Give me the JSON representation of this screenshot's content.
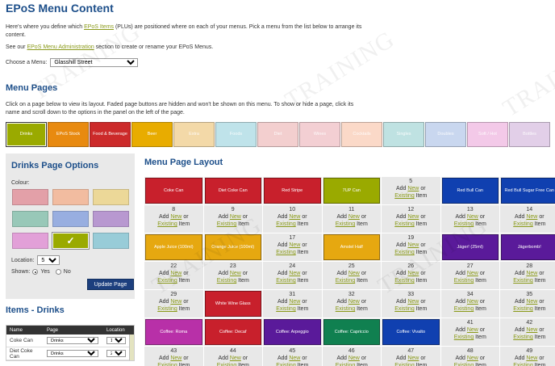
{
  "title": "EPoS Menu Content",
  "intro": {
    "before": "Here's where you define which ",
    "link": "EPoS Items",
    "after": " (PLUs) are positioned where on each of your menus. Pick a menu from the list below to arrange its content."
  },
  "intro2": {
    "before": "See our ",
    "link": "EPoS Menu Administration",
    "after": " section to create or rename your EPoS Menus."
  },
  "choose": {
    "label": "Choose a Menu:",
    "value": "Glasshill Street"
  },
  "watermark": "TRAINING",
  "menu_pages": {
    "heading": "Menu Pages",
    "desc": "Click on a page below to view its layout. Faded page buttons are hidden and won't be shown on this menu. To show or hide a page, click its name and scroll down to the options in the panel on the left of the page.",
    "pages": [
      {
        "label": "Drinks",
        "color": "#9aaa00",
        "faded": false,
        "selected": true
      },
      {
        "label": "EPoS Stock",
        "color": "#e88a10",
        "faded": false
      },
      {
        "label": "Food & Beverage",
        "color": "#cc2a2a",
        "faded": false
      },
      {
        "label": "Beer",
        "color": "#e8ac00",
        "faded": false
      },
      {
        "label": "Extra",
        "color": "#f3d9a8",
        "faded": true
      },
      {
        "label": "Foods",
        "color": "#bfe3ea",
        "faded": true
      },
      {
        "label": "Diet",
        "color": "#f3cfcf",
        "faded": true
      },
      {
        "label": "Wines",
        "color": "#f3cfd3",
        "faded": true
      },
      {
        "label": "Cocktails",
        "color": "#fbd9c8",
        "faded": true
      },
      {
        "label": "Singles",
        "color": "#bfe2e2",
        "faded": true
      },
      {
        "label": "Doubles",
        "color": "#c9d7ef",
        "faded": true
      },
      {
        "label": "Soft / Hot",
        "color": "#f3c9e8",
        "faded": true
      },
      {
        "label": "Bottles",
        "color": "#e2cfe8",
        "faded": true
      }
    ]
  },
  "options": {
    "title": "Drinks Page Options",
    "colour_label": "Colour:",
    "swatches": [
      {
        "color": "#e3a0a8",
        "selected": false,
        "mark": ""
      },
      {
        "color": "#f2bca0",
        "selected": false,
        "mark": ""
      },
      {
        "color": "#ecd898",
        "selected": false,
        "mark": ""
      },
      {
        "color": "#98c8b8",
        "selected": false,
        "mark": ""
      },
      {
        "color": "#98aee0",
        "selected": false,
        "mark": ""
      },
      {
        "color": "#b898d0",
        "selected": false,
        "mark": ""
      },
      {
        "color": "#e2a0d8",
        "selected": false,
        "mark": ""
      },
      {
        "color": "#9aaa00",
        "selected": true,
        "mark": "✓"
      },
      {
        "color": "#98ccd8",
        "selected": false,
        "mark": ""
      }
    ],
    "location_label": "Location:",
    "location_value": "5",
    "shown_label": "Shown:",
    "yes_label": "Yes",
    "no_label": "No",
    "update_label": "Update Page"
  },
  "items": {
    "title": "Items - Drinks",
    "headers": [
      "Name",
      "Page",
      "Location"
    ],
    "rows": [
      {
        "name": "Coke Can",
        "page": "Drinks",
        "location": "1"
      },
      {
        "name": "Diet Coke Can",
        "page": "Drinks",
        "location": "2"
      }
    ]
  },
  "layout": {
    "title": "Menu Page Layout",
    "add": "Add",
    "new": "New",
    "or": "or",
    "existing": "Existing",
    "item": "Item",
    "cells": [
      {
        "type": "item",
        "label": "Coke Can",
        "color": "#c8202c"
      },
      {
        "type": "item",
        "label": "Diet Coke Can",
        "color": "#c8202c"
      },
      {
        "type": "item",
        "label": "Red Stripe",
        "color": "#c8202c"
      },
      {
        "type": "item",
        "label": "7UP Can",
        "color": "#9aaa00"
      },
      {
        "type": "empty",
        "num": "5"
      },
      {
        "type": "item",
        "label": "Red Bull Can",
        "color": "#1040b0"
      },
      {
        "type": "item",
        "label": "Red Bull Sugar Free Can",
        "color": "#1040b0"
      },
      {
        "type": "empty",
        "num": "8"
      },
      {
        "type": "empty",
        "num": "9"
      },
      {
        "type": "empty",
        "num": "10"
      },
      {
        "type": "empty",
        "num": "11"
      },
      {
        "type": "empty",
        "num": "12"
      },
      {
        "type": "empty",
        "num": "13"
      },
      {
        "type": "empty",
        "num": "14"
      },
      {
        "type": "item",
        "label": "Apple Juice (100ml)",
        "color": "#e6a810"
      },
      {
        "type": "item",
        "label": "Orange Juice (100ml)",
        "color": "#e6a810"
      },
      {
        "type": "empty",
        "num": "17"
      },
      {
        "type": "item",
        "label": "Amstel Half",
        "color": "#e6a810"
      },
      {
        "type": "empty",
        "num": "19"
      },
      {
        "type": "item",
        "label": "Jäger! (25ml)",
        "color": "#5a1a9a"
      },
      {
        "type": "item",
        "label": "Jägerbomb!",
        "color": "#5a1a9a"
      },
      {
        "type": "empty",
        "num": "22"
      },
      {
        "type": "empty",
        "num": "23"
      },
      {
        "type": "empty",
        "num": "24"
      },
      {
        "type": "empty",
        "num": "25"
      },
      {
        "type": "empty",
        "num": "26"
      },
      {
        "type": "empty",
        "num": "27"
      },
      {
        "type": "empty",
        "num": "28"
      },
      {
        "type": "empty",
        "num": "29"
      },
      {
        "type": "item",
        "label": "White Wine Glass",
        "color": "#c8202c"
      },
      {
        "type": "empty",
        "num": "31"
      },
      {
        "type": "empty",
        "num": "32"
      },
      {
        "type": "empty",
        "num": "33"
      },
      {
        "type": "empty",
        "num": "34"
      },
      {
        "type": "empty",
        "num": "35"
      },
      {
        "type": "item",
        "label": "Coffee: Roma",
        "color": "#b830a8"
      },
      {
        "type": "item",
        "label": "Coffee: Decaf",
        "color": "#c8202c"
      },
      {
        "type": "item",
        "label": "Coffee: Arpeggio",
        "color": "#5a1a9a"
      },
      {
        "type": "item",
        "label": "Coffee: Capriccio",
        "color": "#108050"
      },
      {
        "type": "item",
        "label": "Coffee: Vivalto",
        "color": "#1040b0"
      },
      {
        "type": "empty",
        "num": "41"
      },
      {
        "type": "empty",
        "num": "42"
      },
      {
        "type": "empty",
        "num": "43"
      },
      {
        "type": "empty",
        "num": "44"
      },
      {
        "type": "empty",
        "num": "45"
      },
      {
        "type": "empty",
        "num": "46"
      },
      {
        "type": "empty",
        "num": "47"
      },
      {
        "type": "empty",
        "num": "48"
      },
      {
        "type": "empty",
        "num": "49"
      }
    ]
  }
}
